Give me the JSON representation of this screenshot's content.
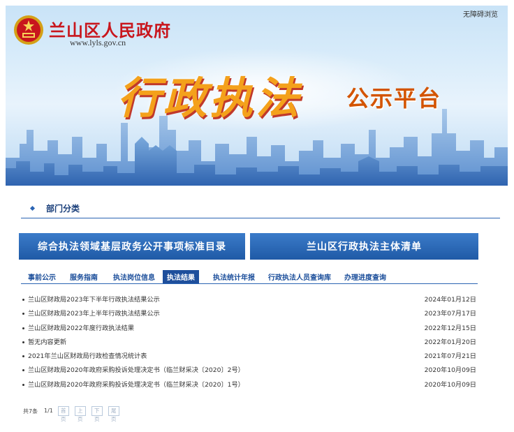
{
  "header": {
    "accessibility_link": "无障碍浏览",
    "site_name": "兰山区人民政府",
    "site_url": "www.lyls.gov.cn",
    "banner_title": "行政执法",
    "banner_subtitle": "公示平台"
  },
  "section": {
    "title": "部门分类"
  },
  "quick_links": {
    "left": "综合执法领域基层政务公开事项标准目录",
    "right": "兰山区行政执法主体清单"
  },
  "tabs": [
    {
      "label": "事前公示",
      "active": false
    },
    {
      "label": "服务指南",
      "active": false
    },
    {
      "label": "执法岗位信息",
      "active": false
    },
    {
      "label": "执法结果",
      "active": true
    },
    {
      "label": "执法统计年报",
      "active": false
    },
    {
      "label": "行政执法人员查询库",
      "active": false
    },
    {
      "label": "办理进度查询",
      "active": false
    }
  ],
  "list": [
    {
      "title": "兰山区财政局2023年下半年行政执法结果公示",
      "date": "2024年01月12日"
    },
    {
      "title": "兰山区财政局2023年上半年行政执法结果公示",
      "date": "2023年07月17日"
    },
    {
      "title": "兰山区财政局2022年度行政执法结果",
      "date": "2022年12月15日"
    },
    {
      "title": "暂无内容更新",
      "date": "2022年01月20日"
    },
    {
      "title": "2021年兰山区财政局行政检查情况统计表",
      "date": "2021年07月21日"
    },
    {
      "title": "兰山区财政局2020年政府采购投诉处理决定书（临兰财采决〔2020〕2号）",
      "date": "2020年10月09日"
    },
    {
      "title": "兰山区财政局2020年政府采购投诉处理决定书（临兰财采决〔2020〕1号）",
      "date": "2020年10月09日"
    }
  ],
  "pager": {
    "total": "共7条",
    "page": "1/1",
    "first": "首页",
    "prev": "上页",
    "next": "下页",
    "last": "尾页"
  },
  "colors": {
    "brand_red": "#c8161d",
    "nav_blue": "#1e4f9c",
    "title_orange": "#f4a11b"
  }
}
